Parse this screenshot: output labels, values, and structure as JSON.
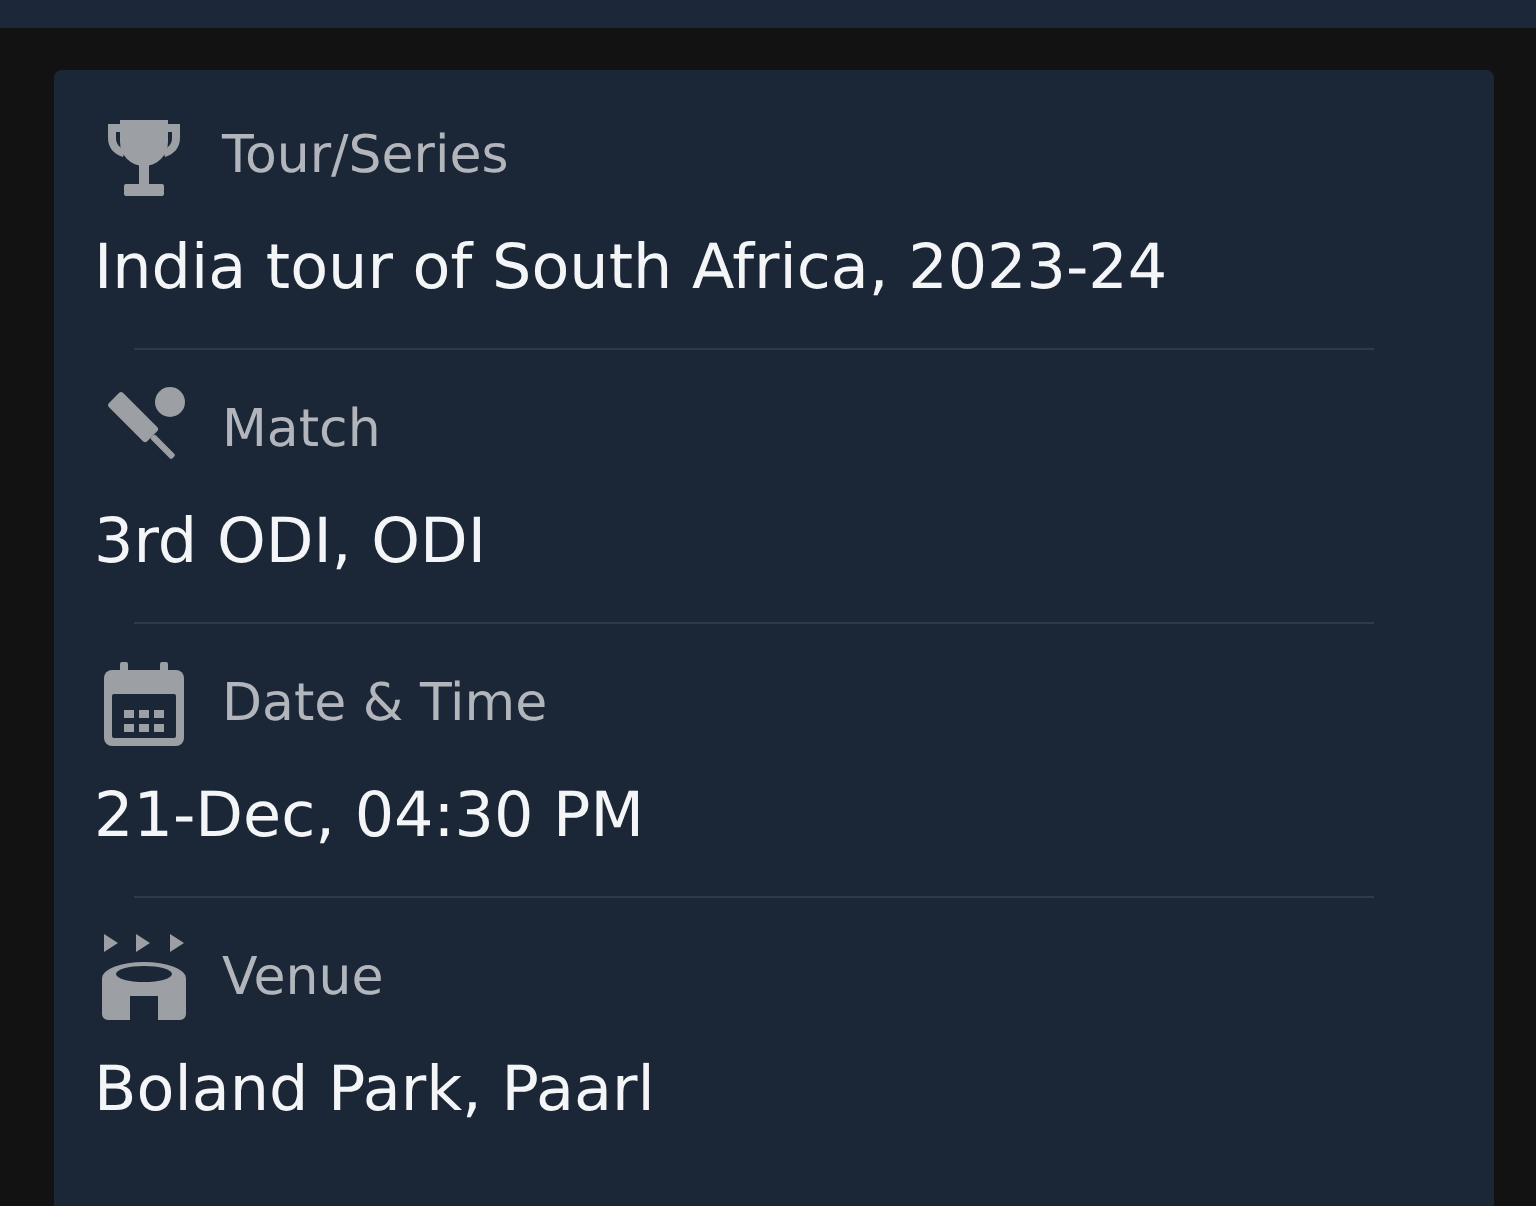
{
  "details": [
    {
      "kind": "series",
      "label": "Tour/Series",
      "value": "India tour of South Africa, 2023-24"
    },
    {
      "kind": "match",
      "label": "Match",
      "value": "3rd ODI, ODI"
    },
    {
      "kind": "datetime",
      "label": "Date & Time",
      "value": "21-Dec, 04:30 PM"
    },
    {
      "kind": "venue",
      "label": "Venue",
      "value": "Boland Park, Paarl"
    }
  ]
}
